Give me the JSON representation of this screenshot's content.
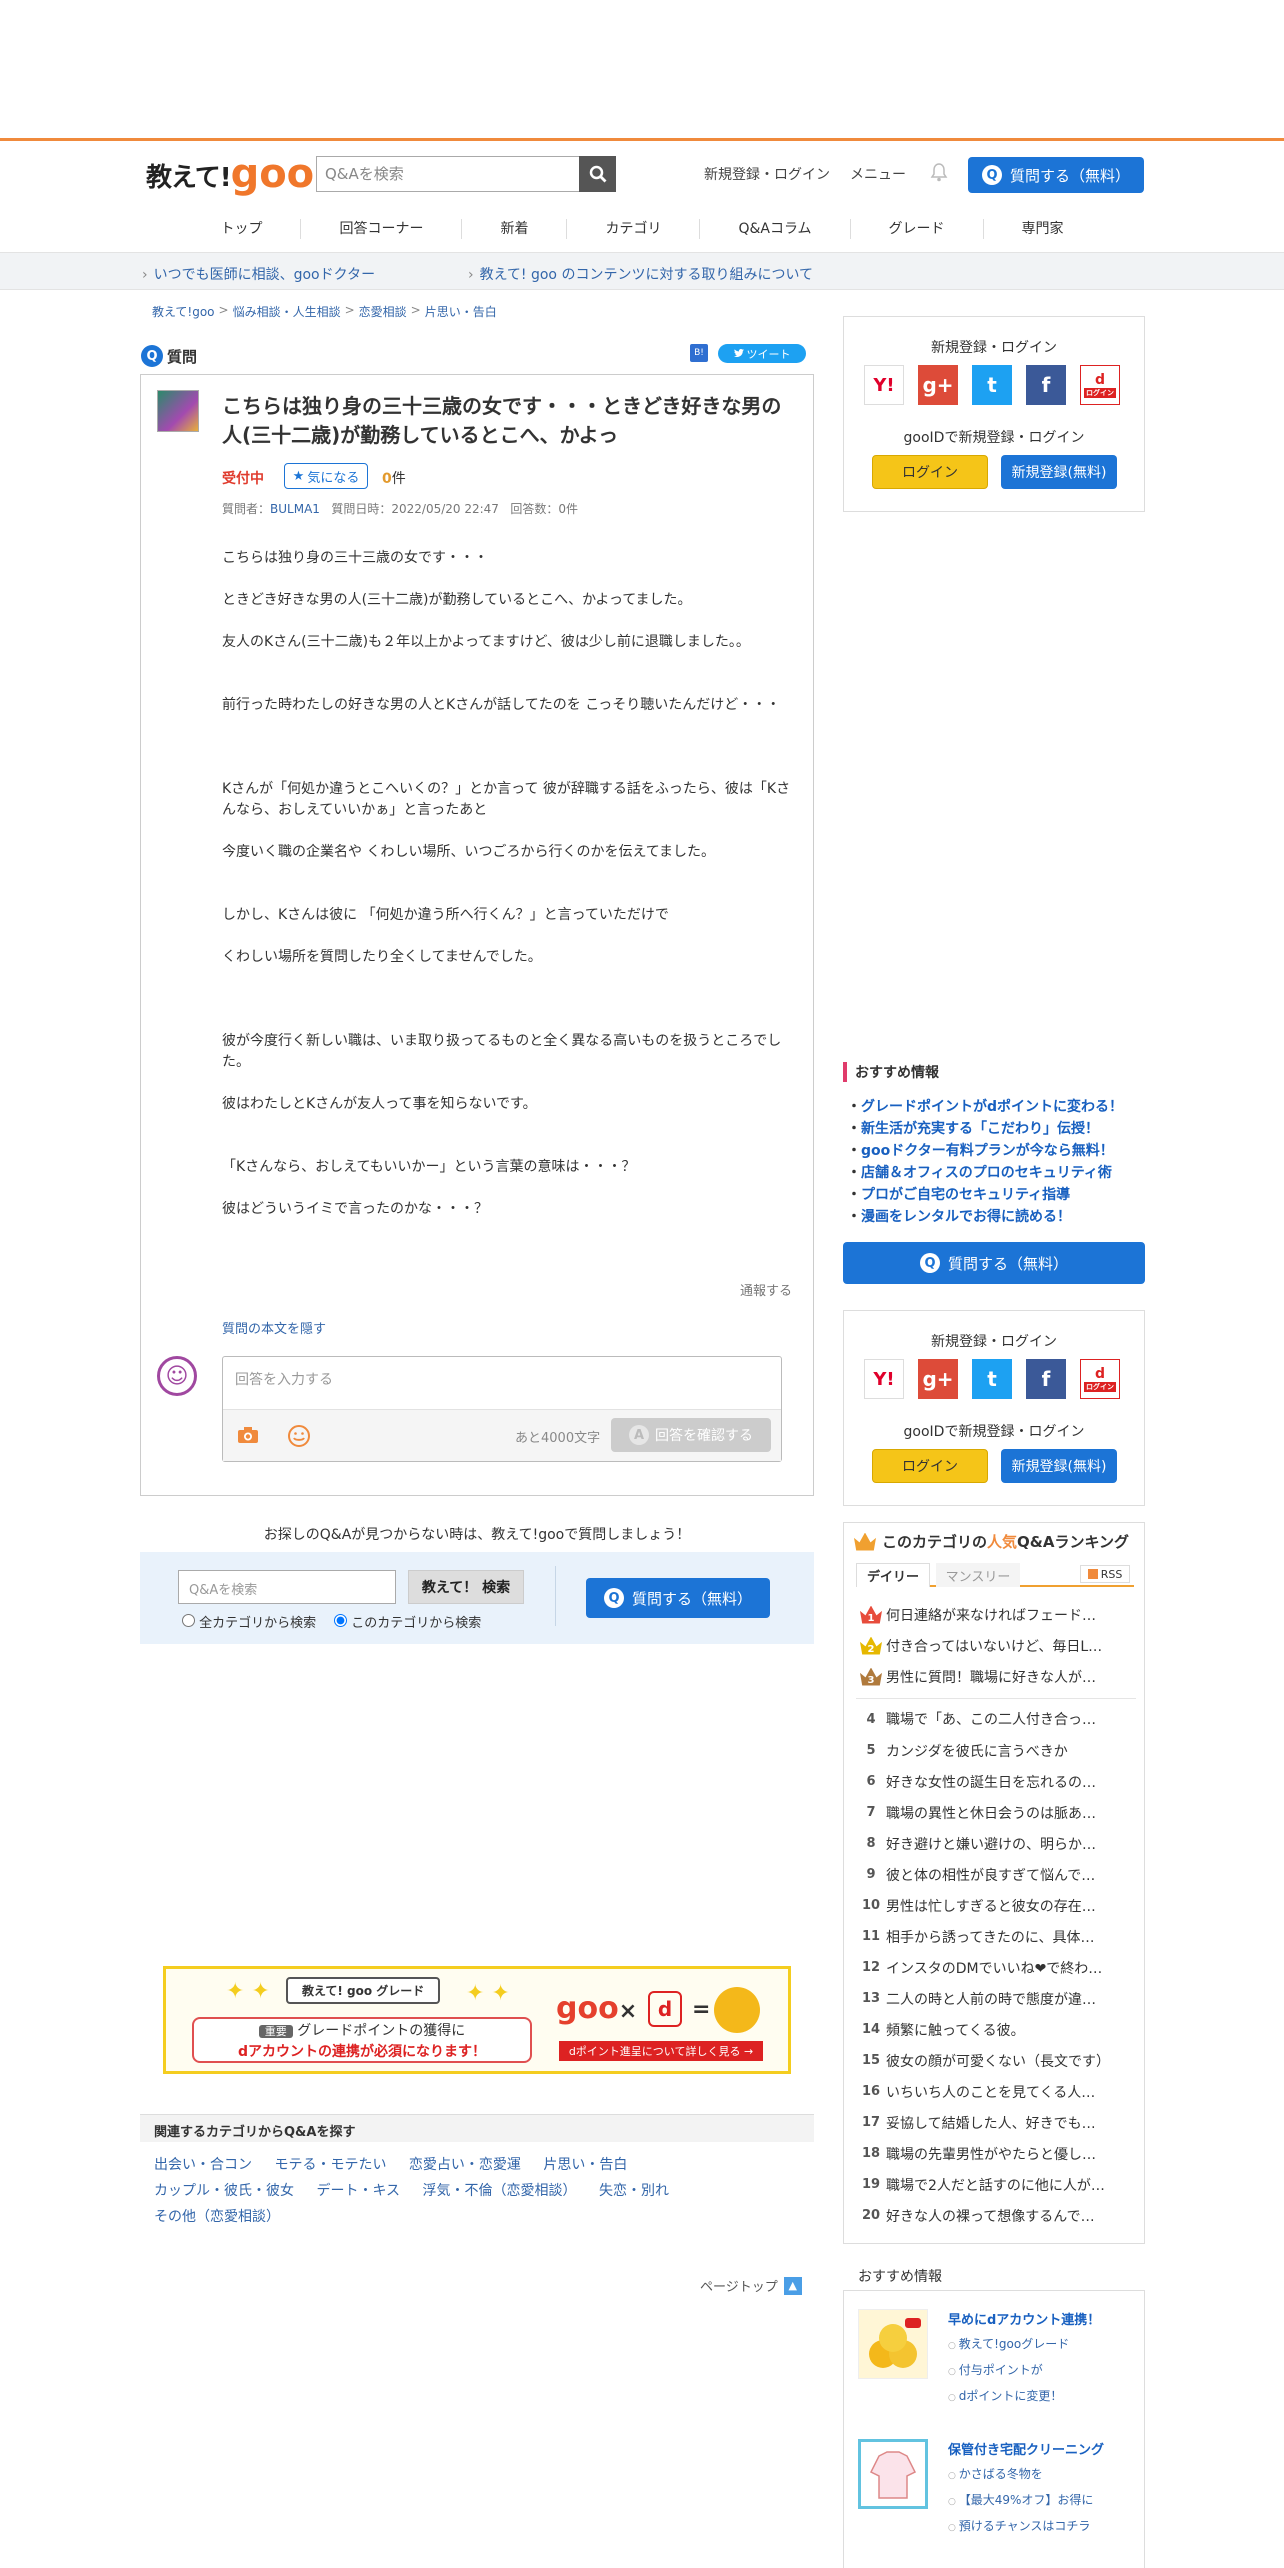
{
  "header": {
    "logo_part1": "教えて!",
    "logo_part2": "goo",
    "search_placeholder": "Q&Aを検索",
    "login_link": "新規登録・ログイン",
    "menu_link": "メニュー",
    "ask_button": "質問する（無料）",
    "q_icon": "Q"
  },
  "nav": {
    "items": [
      "トップ",
      "回答コーナー",
      "新着",
      "カテゴリ",
      "Q&Aコラム",
      "グレード",
      "専門家"
    ]
  },
  "subbar": {
    "link1": "いつでも医師に相談、gooドクター",
    "link2": "教えて! goo のコンテンツに対する取り組みについて"
  },
  "breadcrumb": [
    "教えて!goo",
    "悩み相談・人生相談",
    "恋愛相談",
    "片思い・告白"
  ],
  "breadcrumb_sep": ">",
  "question": {
    "section_label": "質問",
    "tweet": "ツイート",
    "bookmark": "B!",
    "title": "こちらは独り身の三十三歳の女です・・・ときどき好きな男の人(三十二歳)が勤務しているとこへ、かよっ",
    "status": "受付中",
    "follow_button": "気になる",
    "follow_count": "0",
    "follow_unit": "件",
    "meta_questioner_label": "質問者：",
    "meta_questioner": "BULMA1",
    "meta_date": "質問日時：2022/05/20 22:47",
    "meta_answers": "回答数：0件",
    "body": [
      "こちらは独り身の三十三歳の女です・・・",
      "",
      "ときどき好きな男の人(三十二歳)が勤務しているとこへ、かよってました。",
      "",
      "友人のKさん(三十二歳)も２年以上かよってますけど、彼は少し前に退職しました。。",
      "",
      "",
      "前行った時わたしの好きな男の人とKさんが話してたのを こっそり聴いたんだけど・・・",
      "",
      "",
      "",
      "Kさんが「何処か違うとこへいくの？」とか言って 彼が辞職する話をふったら、彼は「Kさんなら、おしえていいかぁ」と言ったあと",
      "",
      "今度いく職の企業名や くわしい場所、いつごろから行くのかを伝えてました。",
      "",
      "",
      "しかし、Kさんは彼に 「何処か違う所へ行くん？」と言っていただけで",
      "",
      "くわしい場所を質問したり全くしてませんでした。",
      "",
      "",
      "",
      "彼が今度行く新しい職は、いま取り扱ってるものと全く異なる高いものを扱うところでした。",
      "",
      "彼はわたしとKさんが友人って事を知らないです。",
      "",
      "",
      "「Kさんなら、おしえてもいいかー」という言葉の意味は・・・？",
      "",
      "彼はどういうイミで言ったのかな・・・？"
    ],
    "report_link": "通報する",
    "hide_link": "質問の本文を隠す"
  },
  "answer": {
    "placeholder": "回答を入力する",
    "remaining": "あと4000文字",
    "confirm_button": "回答を確認する",
    "confirm_icon": "A"
  },
  "search2": {
    "notice": "お探しのQ&Aが見つからない時は、教えて!gooで質問しましょう！",
    "placeholder": "Q&Aを検索",
    "button": "教えて！ 検索",
    "radio_all": "全カテゴリから検索",
    "radio_this": "このカテゴリから検索",
    "ask_button": "質問する（無料）"
  },
  "banner": {
    "label": "教えて! goo グレード",
    "badge": "重要",
    "message_line1": "グレードポイントの獲得に",
    "message_line2": "dアカウントの連携が必須になります！",
    "logo": "goo",
    "times": "×",
    "d_label": "d",
    "equals": "=",
    "link": "dポイント進呈について詳しく見る →"
  },
  "related": {
    "title": "関連するカテゴリからQ&Aを探す",
    "links": [
      "出会い・合コン",
      "モテる・モテたい",
      "恋愛占い・恋愛運",
      "片思い・告白",
      "カップル・彼氏・彼女",
      "デート・キス",
      "浮気・不倫（恋愛相談）",
      "失恋・別れ",
      "その他（恋愛相談）"
    ]
  },
  "pagetop": "ページトップ",
  "sidebar": {
    "login_title": "新規登録・ログイン",
    "gooid_text": "gooIDで新規登録・ログイン",
    "login_button": "ログイン",
    "register_button": "新規登録(無料)",
    "social": {
      "yahoo": "Y!",
      "google": "g+",
      "twitter": "t",
      "facebook": "f",
      "docomo": "d"
    },
    "docomo_sub": "ログイン",
    "rec_title": "おすすめ情報",
    "rec_links": [
      "グレードポイントがdポイントに変わる！",
      "新生活が充実する「こだわり」伝授！",
      "gooドクター有料プランが今なら無料！",
      "店舗＆オフィスのプロのセキュリティ術",
      "プロがご自宅のセキュリティ指導",
      "漫画をレンタルでお得に読める！"
    ],
    "ask_button": "質問する（無料）"
  },
  "ranking": {
    "title_pre": "このカテゴリの",
    "title_hl": "人気",
    "title_post": "Q&Aランキング",
    "tab_daily": "デイリー",
    "tab_monthly": "マンスリー",
    "rss": "RSS",
    "items": [
      {
        "rank": "1",
        "title": "何日連絡が来なければフェード…"
      },
      {
        "rank": "2",
        "title": "付き合ってはいないけど、毎日L…"
      },
      {
        "rank": "3",
        "title": "男性に質問！職場に好きな人が…"
      },
      {
        "rank": "4",
        "title": "職場で「あ、この二人付き合っ…"
      },
      {
        "rank": "5",
        "title": "カンジダを彼氏に言うべきか"
      },
      {
        "rank": "6",
        "title": "好きな女性の誕生日を忘れるの…"
      },
      {
        "rank": "7",
        "title": "職場の異性と休日会うのは脈あ…"
      },
      {
        "rank": "8",
        "title": "好き避けと嫌い避けの、明らか…"
      },
      {
        "rank": "9",
        "title": "彼と体の相性が良すぎて悩んで…"
      },
      {
        "rank": "10",
        "title": "男性は忙しすぎると彼女の存在…"
      },
      {
        "rank": "11",
        "title": "相手から誘ってきたのに、具体…"
      },
      {
        "rank": "12",
        "title": "インスタのDMでいいね❤で終わ…"
      },
      {
        "rank": "13",
        "title": "二人の時と人前の時で態度が違…"
      },
      {
        "rank": "14",
        "title": "頻繁に触ってくる彼。"
      },
      {
        "rank": "15",
        "title": "彼女の顔が可愛くない（長文です）"
      },
      {
        "rank": "16",
        "title": "いちいち人のことを見てくる人…"
      },
      {
        "rank": "17",
        "title": "妥協して結婚した人、好きでも…"
      },
      {
        "rank": "18",
        "title": "職場の先輩男性がやたらと優し…"
      },
      {
        "rank": "19",
        "title": "職場で2人だと話すのに他に人が…"
      },
      {
        "rank": "20",
        "title": "好きな人の裸って想像するんで…"
      }
    ]
  },
  "rec2": {
    "title": "おすすめ情報",
    "block1_head": "早めにdアカウント連携！",
    "block1_items": [
      "教えて!gooグレード",
      "付与ポイントが",
      "dポイントに変更！"
    ],
    "block2_head": "保管付き宅配クリーニング",
    "block2_items": [
      "かさばる冬物を",
      "【最大49%オフ】お得に",
      "預けるチャンスはコチラ"
    ]
  },
  "colors": {
    "accent": "#f08a3c",
    "brand_blue": "#1c74d6",
    "status_red": "#e03b2d"
  }
}
